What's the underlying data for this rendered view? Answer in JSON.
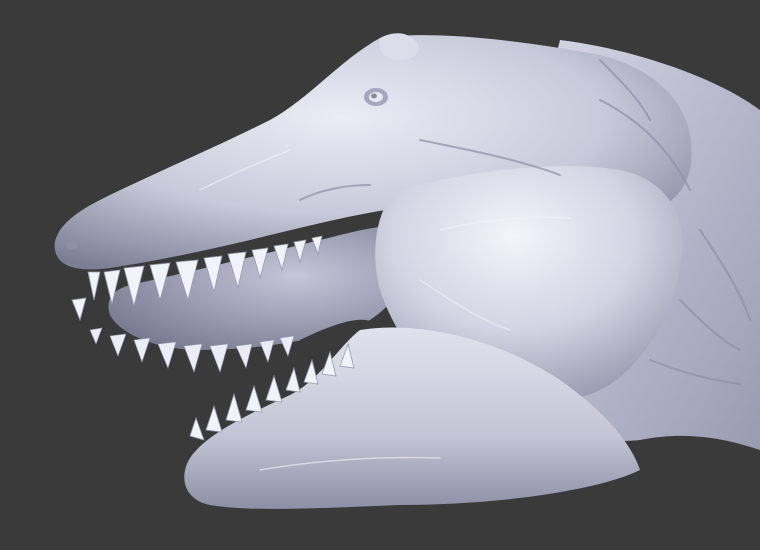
{
  "scene": {
    "subject": "",
    "background_color": "#3a3a3a",
    "material_color": "#c8c8da",
    "highlight_color": "#f2f2fa",
    "shadow_color": "#6a6a80",
    "mouth_interior_color": "#b0b0c8",
    "tooth_color": "#f0f0f8"
  }
}
